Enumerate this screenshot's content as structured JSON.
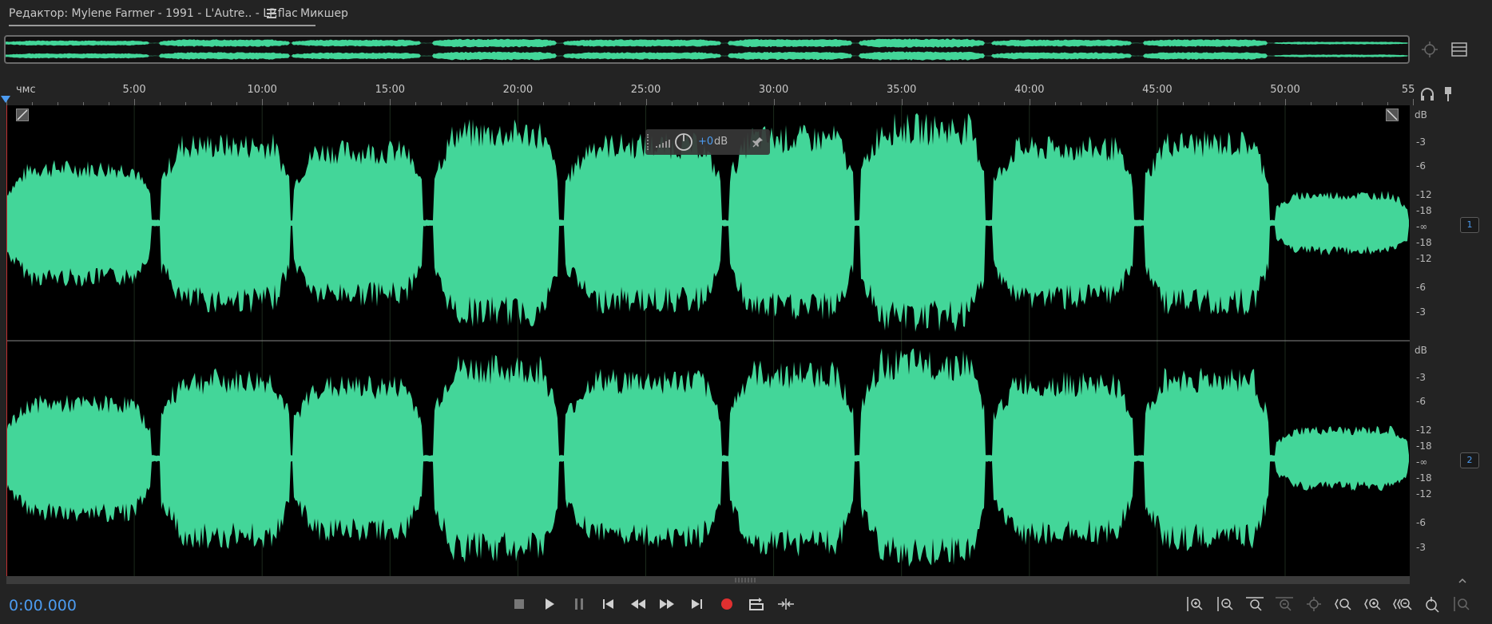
{
  "tabs": {
    "editor_label": "Редактор: Mylene Farmer - 1991 - L'Autre.. - LP.flac",
    "mixer_label": "Микшер"
  },
  "ruler": {
    "unit_label": "чмс",
    "ticks": [
      "5:00",
      "10:00",
      "15:00",
      "20:00",
      "25:00",
      "30:00",
      "35:00",
      "40:00",
      "45:00",
      "50:00",
      "55"
    ]
  },
  "hud": {
    "gain_value": "+0",
    "gain_unit": "dB"
  },
  "db_scale": {
    "labels": [
      "dB",
      "-3",
      "-6",
      "-12",
      "-18",
      "-∞",
      "-18",
      "-12",
      "-6",
      "-3"
    ]
  },
  "channels": [
    "1",
    "2"
  ],
  "transport": {
    "timecode": "0:00.000"
  },
  "colors": {
    "waveform": "#43d699",
    "accent": "#4c9bf0",
    "record": "#e03030",
    "background": "#232323"
  },
  "icons": {
    "stop": "stop-icon",
    "play": "play-icon",
    "pause": "pause-icon",
    "to_start": "skip-to-start-icon",
    "rewind": "rewind-icon",
    "fast_forward": "fast-forward-icon",
    "to_end": "skip-to-end-icon",
    "record": "record-icon",
    "loop": "loop-playback-icon",
    "skip": "skip-selection-icon"
  }
}
